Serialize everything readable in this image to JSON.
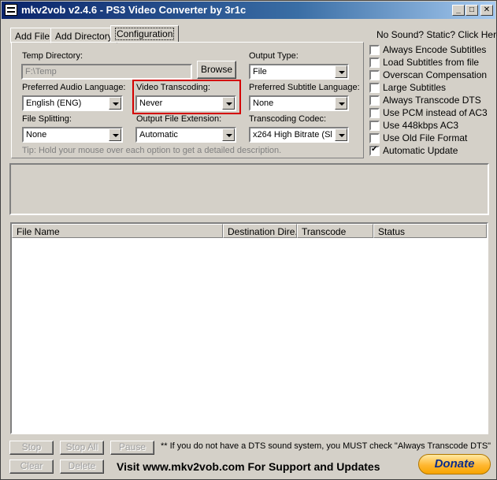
{
  "window": {
    "title": "mkv2vob v2.4.6 - PS3 Video Converter by 3r1c",
    "minimize": "_",
    "maximize": "□",
    "close": "✕"
  },
  "tabs": [
    {
      "label": "Add File",
      "active": false
    },
    {
      "label": "Add Directory",
      "active": false
    },
    {
      "label": "Configuration",
      "active": true
    }
  ],
  "help_link": "No Sound? Static? Click Here",
  "config": {
    "temp_directory": {
      "label": "Temp Directory:",
      "value": "F:\\Temp",
      "browse_label": "Browse"
    },
    "output_type": {
      "label": "Output Type:",
      "value": "File"
    },
    "preferred_audio": {
      "label": "Preferred Audio Language:",
      "value": "English (ENG)"
    },
    "video_transcoding": {
      "label": "Video Transcoding:",
      "value": "Never"
    },
    "preferred_subtitle": {
      "label": "Preferred Subtitle Language:",
      "value": "None"
    },
    "file_splitting": {
      "label": "File Splitting:",
      "value": "None"
    },
    "output_extension": {
      "label": "Output File Extension:",
      "value": "Automatic"
    },
    "transcoding_codec": {
      "label": "Transcoding Codec:",
      "value": "x264 High Bitrate (Slow)"
    },
    "tip": "Tip: Hold your mouse over each option to get a detailed description."
  },
  "options": [
    {
      "label": "Always Encode Subtitles",
      "checked": false
    },
    {
      "label": "Load Subtitles from file",
      "checked": false
    },
    {
      "label": "Overscan Compensation",
      "checked": false
    },
    {
      "label": "Large Subtitles",
      "checked": false
    },
    {
      "label": "Always Transcode DTS",
      "checked": false
    },
    {
      "label": "Use PCM instead of AC3",
      "checked": false
    },
    {
      "label": "Use 448kbps AC3",
      "checked": false
    },
    {
      "label": "Use Old File Format",
      "checked": false
    },
    {
      "label": "Automatic Update",
      "checked": true
    }
  ],
  "file_list": {
    "columns": [
      "File Name",
      "Destination Dire...",
      "Transcode",
      "Status"
    ],
    "rows": []
  },
  "buttons": {
    "stop": "Stop",
    "stop_all": "Stop All",
    "pause": "Pause",
    "clear": "Clear",
    "delete": "Delete",
    "donate": "Donate"
  },
  "footer": {
    "dts_note": "** If you do not have a DTS sound system, you MUST check \"Always Transcode DTS\"",
    "visit": "Visit www.mkv2vob.com For Support and Updates"
  },
  "colors": {
    "highlight_box": "#d40000",
    "titlebar": "#0a246a",
    "donate_text": "#0c2d8a"
  }
}
